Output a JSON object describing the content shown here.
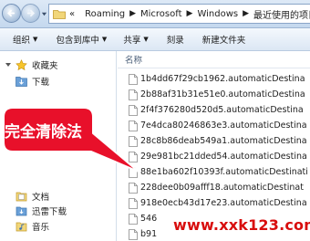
{
  "address": {
    "chevron": "«",
    "segments": [
      "Roaming",
      "Microsoft",
      "Windows",
      "最近使用的项目"
    ],
    "separator": "▶"
  },
  "toolbar": {
    "organize": "组织",
    "include_in_library": "包含到库中",
    "share": "共享",
    "burn": "刻录",
    "new_folder": "新建文件夹",
    "caret": "▼"
  },
  "nav": {
    "favorites": "收藏夹",
    "downloads": "下载",
    "documents": "文档",
    "xunlei_download": "迅雷下载",
    "music": "音乐"
  },
  "files": {
    "column_name": "名称",
    "items": [
      "1b4dd67f29cb1962.automaticDestina",
      "2b88af31b31e51e0.automaticDestina",
      "2f4f376280d520d5.automaticDestina",
      "7e4dca80246863e3.automaticDestina",
      "28c8b86deab549a1.automaticDestina",
      "29e981bc21dded54.automaticDestina",
      "88e1ba602f10393f.automaticDestinati",
      "228dee0b09afff18.automaticDestinat",
      "918e0ecb43d17e23.automaticDestina",
      "546",
      "b91"
    ]
  },
  "callout": {
    "text": "完全清除法",
    "color": "#e8102a"
  },
  "watermark": {
    "text": "www.xxk123.com",
    "color": "#d80d0d"
  }
}
